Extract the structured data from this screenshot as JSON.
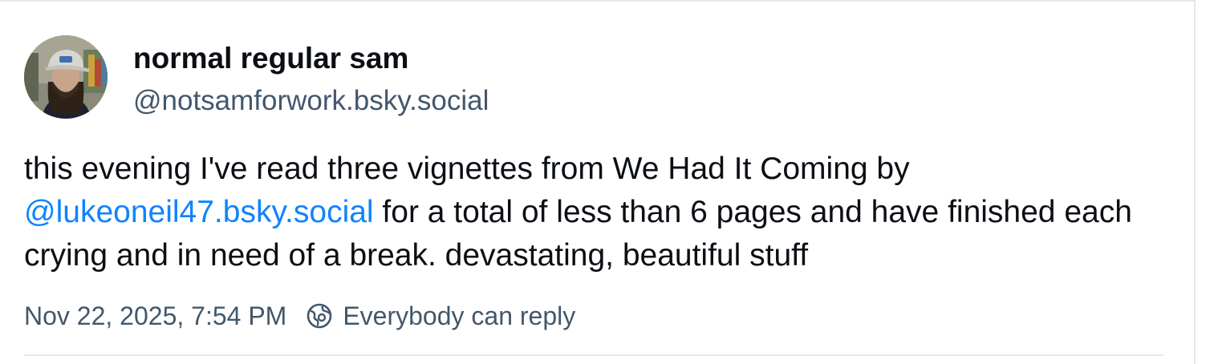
{
  "post": {
    "author": {
      "display_name": "normal regular sam",
      "handle": "@notsamforwork.bsky.social",
      "avatar_icon": "user-avatar-photo"
    },
    "text_before_mention": "this evening I've read three vignettes from We Had It Coming by ",
    "mention": "@lukeoneil47.bsky.social",
    "text_after_mention": " for a total of less than 6 pages and have finished each crying and in need of a break. devastating, beautiful stuff",
    "timestamp": "Nov 22, 2025, 7:54 PM",
    "reply_setting": {
      "icon": "globe-reply-icon",
      "label": "Everybody can reply"
    }
  },
  "colors": {
    "text": "#0b0f14",
    "muted": "#42576c",
    "link": "#1083fe",
    "border": "#e4e7ec"
  }
}
